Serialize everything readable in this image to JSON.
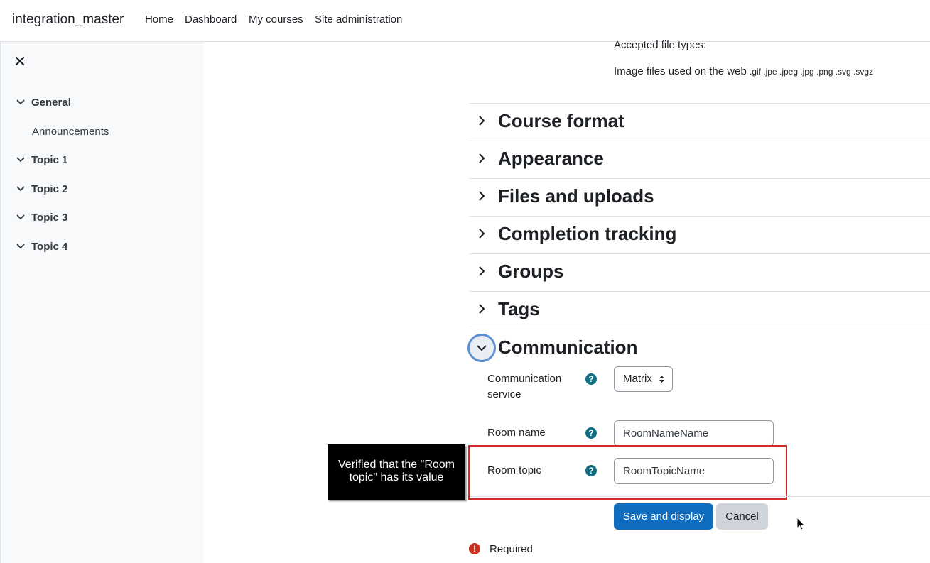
{
  "navbar": {
    "brand": "integration_master",
    "links": [
      "Home",
      "Dashboard",
      "My courses",
      "Site administration"
    ]
  },
  "drawer": {
    "close_icon": "close-icon",
    "sections": [
      {
        "label": "General",
        "items": [
          "Announcements"
        ]
      },
      {
        "label": "Topic 1",
        "items": []
      },
      {
        "label": "Topic 2",
        "items": []
      },
      {
        "label": "Topic 3",
        "items": []
      },
      {
        "label": "Topic 4",
        "items": []
      }
    ]
  },
  "main": {
    "accepted_label": "Accepted file types:",
    "filetypes_text": "Image files used on the web",
    "filetypes_ext": ".gif .jpe .jpeg .jpg .png .svg .svgz",
    "sections": [
      "Course format",
      "Appearance",
      "Files and uploads",
      "Completion tracking",
      "Groups",
      "Tags"
    ],
    "communication": {
      "title": "Communication",
      "service_label_1": "Communication",
      "service_label_2": "service",
      "service_value": "Matrix",
      "room_name_label": "Room name",
      "room_name_value": "RoomNameName",
      "room_topic_label": "Room topic",
      "room_topic_value": "RoomTopicName"
    },
    "callout": "Verified that the \"Room topic\" has its value",
    "buttons": {
      "save": "Save and display",
      "cancel": "Cancel"
    },
    "required": "Required"
  },
  "colors": {
    "primary": "#0f6cbf",
    "help": "#0f6e81",
    "required": "#ca3120",
    "highlight": "#d42b2b"
  }
}
